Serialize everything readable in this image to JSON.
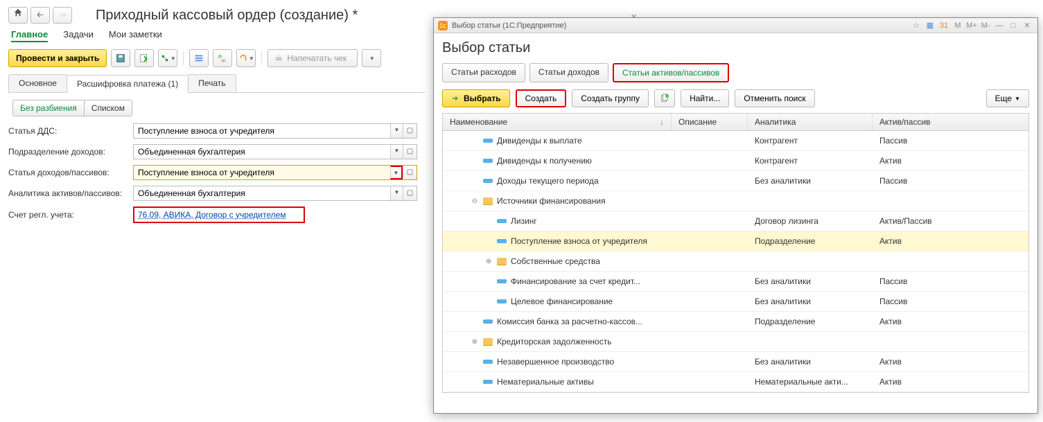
{
  "header": {
    "title": "Приходный кассовый ордер (создание) *"
  },
  "modes": {
    "main": "Главное",
    "tasks": "Задачи",
    "notes": "Мои заметки"
  },
  "toolbar": {
    "post_close": "Провести и закрыть",
    "print_label": "Напечатать чек"
  },
  "tabs": {
    "main": "Основное",
    "detail": "Расшифровка платежа (1)",
    "print": "Печать"
  },
  "view": {
    "none": "Без разбиения",
    "list": "Списком"
  },
  "form": {
    "dds_label": "Статья ДДС:",
    "dds_value": "Поступление взноса от учредителя",
    "dept_label": "Подразделение доходов:",
    "dept_value": "Объединенная бухгалтерия",
    "income_label": "Статья доходов/пассивов:",
    "income_value": "Поступление взноса от учредителя",
    "analytics_label": "Аналитика активов/пассивов:",
    "analytics_value": "Объединенная бухгалтерия",
    "acct_label": "Счет регл. учета:",
    "acct_value": "76.09, АВИКА, Договор с учредителем"
  },
  "dialog": {
    "window_title": "Выбор статьи  (1С:Предприятие)",
    "title": "Выбор статьи",
    "tabs": {
      "expenses": "Статьи расходов",
      "income": "Статьи доходов",
      "assets": "Статьи активов/пассивов"
    },
    "actions": {
      "select": "Выбрать",
      "create": "Создать",
      "create_group": "Создать группу",
      "find": "Найти...",
      "cancel_search": "Отменить поиск",
      "more": "Еще"
    },
    "columns": {
      "name": "Наименование",
      "desc": "Описание",
      "analytics": "Аналитика",
      "type": "Актив/пассив"
    },
    "rows": [
      {
        "indent": 1,
        "kind": "leaf",
        "name": "Дивиденды к выплате",
        "analytics": "Контрагент",
        "type": "Пассив"
      },
      {
        "indent": 1,
        "kind": "leaf",
        "name": "Дивиденды к получению",
        "analytics": "Контрагент",
        "type": "Актив"
      },
      {
        "indent": 1,
        "kind": "leaf",
        "name": "Доходы текущего периода",
        "analytics": "Без аналитики",
        "type": "Пассив"
      },
      {
        "indent": 1,
        "kind": "folder",
        "exp": "⊖",
        "name": "Источники финансирования",
        "analytics": "",
        "type": ""
      },
      {
        "indent": 2,
        "kind": "leaf",
        "name": "Лизинг",
        "analytics": "Договор лизинга",
        "type": "Актив/Пассив"
      },
      {
        "indent": 2,
        "kind": "leaf",
        "sel": true,
        "name": "Поступление взноса от учредителя",
        "analytics": "Подразделение",
        "type": "Актив"
      },
      {
        "indent": 2,
        "kind": "folder",
        "exp": "⊕",
        "name": "Собственные средства",
        "analytics": "",
        "type": ""
      },
      {
        "indent": 2,
        "kind": "leaf",
        "name": "Финансирование за счет кредит...",
        "analytics": "Без аналитики",
        "type": "Пассив"
      },
      {
        "indent": 2,
        "kind": "leaf",
        "name": "Целевое финансирование",
        "analytics": "Без аналитики",
        "type": "Пассив"
      },
      {
        "indent": 1,
        "kind": "leaf",
        "name": "Комиссия банка за расчетно-кассов...",
        "analytics": "Подразделение",
        "type": "Актив"
      },
      {
        "indent": 1,
        "kind": "folder",
        "exp": "⊕",
        "name": "Кредиторская задолженность",
        "analytics": "",
        "type": ""
      },
      {
        "indent": 1,
        "kind": "leaf",
        "name": "Незавершенное производство",
        "analytics": "Без аналитики",
        "type": "Актив"
      },
      {
        "indent": 1,
        "kind": "leaf",
        "name": "Нематериальные активы",
        "analytics": "Нематериальные акти...",
        "type": "Актив"
      }
    ]
  }
}
